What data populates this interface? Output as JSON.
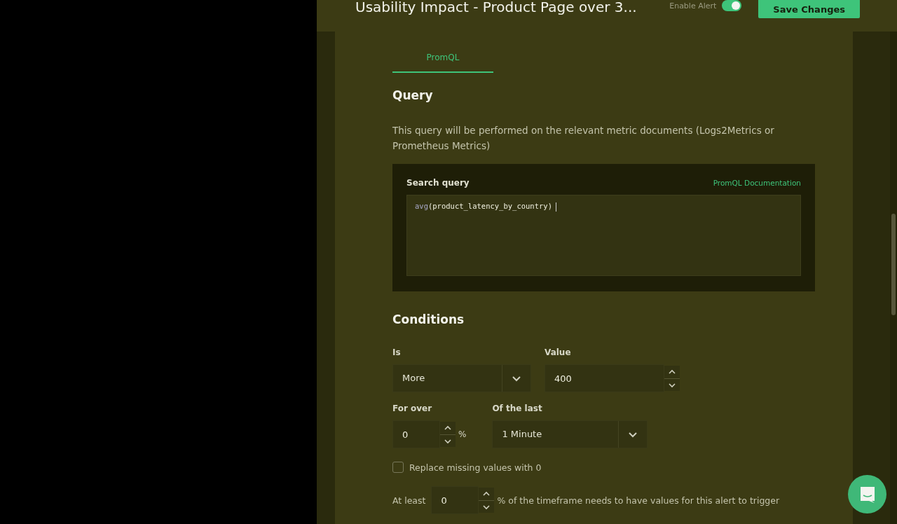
{
  "header": {
    "title": "Usability Impact - Product Page over 3...",
    "enable_alert": {
      "label": "Enable Alert",
      "on": true
    },
    "save_button": "Save Changes"
  },
  "tabs": [
    {
      "label": "PromQL",
      "selected": true
    }
  ],
  "query": {
    "heading": "Query",
    "description": "This query will be performed on the relevant metric documents (Logs2Metrics or Prometheus Metrics)",
    "search_label": "Search query",
    "doc_link": "PromQL Documentation",
    "query_function": "avg",
    "query_rest": "(product_latency_by_country)"
  },
  "conditions": {
    "heading": "Conditions",
    "is": {
      "label": "Is",
      "value": "More"
    },
    "value": {
      "label": "Value",
      "value": "400"
    },
    "for_over": {
      "label": "For over",
      "value": "0",
      "unit": "%"
    },
    "of_the_last": {
      "label": "Of the last",
      "value": "1 Minute"
    },
    "replace_missing": {
      "label": "Replace missing values with 0",
      "checked": false
    },
    "at_least": {
      "prefix": "At least",
      "value": "0",
      "suffix": "% of the timeframe needs to have values for this alert to trigger"
    }
  }
}
